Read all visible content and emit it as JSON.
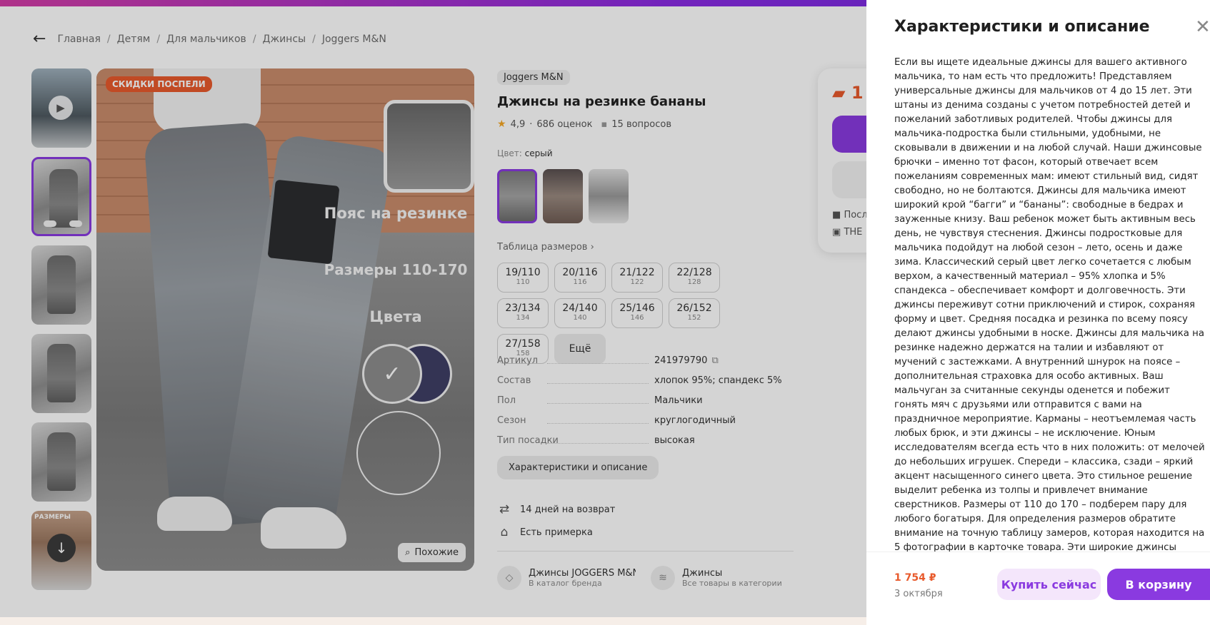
{
  "breadcrumbs": [
    "Главная",
    "Детям",
    "Для мальчиков",
    "Джинсы",
    "Joggers M&N"
  ],
  "gallery": {
    "badge": "СКИДКИ ПОСПЕЛИ",
    "promo_belt": "Пояс на резинке",
    "promo_sizes": "Размеры 110-170",
    "promo_colors": "Цвета",
    "similar_label": "Похожие",
    "thumb_label": "РАЗМЕРЫ"
  },
  "product": {
    "brand": "Joggers M&N",
    "title": "Джинсы на резинке бананы",
    "rating": "4,9",
    "reviews": "686 оценок",
    "questions": "15 вопросов",
    "color_label": "Цвет:",
    "color_value": "серый",
    "size_table_label": "Таблица размеров",
    "sizes": [
      {
        "size": "19/110",
        "height": "110"
      },
      {
        "size": "20/116",
        "height": "116"
      },
      {
        "size": "21/122",
        "height": "122"
      },
      {
        "size": "22/128",
        "height": "128"
      },
      {
        "size": "23/134",
        "height": "134"
      },
      {
        "size": "24/140",
        "height": "140"
      },
      {
        "size": "25/146",
        "height": "146"
      },
      {
        "size": "26/152",
        "height": "152"
      },
      {
        "size": "27/158",
        "height": "158"
      }
    ],
    "sizes_more": "Ещё",
    "specs": [
      {
        "key": "Артикул",
        "value": "241979790"
      },
      {
        "key": "Состав",
        "value": "хлопок 95%; спандекс 5%"
      },
      {
        "key": "Пол",
        "value": "Мальчики"
      },
      {
        "key": "Сезон",
        "value": "круглогодичный"
      },
      {
        "key": "Тип посадки",
        "value": "высокая"
      }
    ],
    "desc_button": "Характеристики и описание",
    "returns": "14 дней на возврат",
    "fitting": "Есть примерка",
    "link_brand_title": "Джинсы JOGGERS M&N",
    "link_brand_sub": "В каталог бренда",
    "link_cat_title": "Джинсы",
    "link_cat_sub": "Все товары в категории"
  },
  "buybox": {
    "price_partial": "1",
    "line1": "Посл",
    "line2": "THE"
  },
  "panel": {
    "title": "Характеристики и описание",
    "description": "Если вы ищете идеальные джинсы для вашего активного мальчика, то нам есть что предложить! Представляем универсальные джинсы для мальчиков от 4 до 15 лет. Эти штаны из денима созданы с учетом потребностей детей и пожеланий заботливых родителей. Чтобы джинсы для мальчика-подростка были стильными, удобными, не сковывали в движении и на любой случай. Наши джинсовые брючки – именно тот фасон, который отвечает всем пожеланиям современных мам: имеют стильный вид, сидят свободно, но не болтаются. Джинсы для мальчика имеют широкий крой “багги” и “бананы”: свободные в бедрах и зауженные книзу. Ваш ребенок может быть активным весь день, не чувствуя стеснения. Джинсы подростковые для мальчика подойдут на любой сезон – лето, осень и даже зима. Классический серый цвет легко сочетается с любым верхом, а качественный материал – 95% хлопка и 5% спандекса – обеспечивает комфорт и долговечность. Эти джинсы переживут сотни приключений и стирок, сохраняя форму и цвет. Средняя посадка и резинка по всему поясу делают джинсы удобными в носке. Джинсы для мальчика на резинке надежно держатся на талии и избавляют от мучений с застежками. А внутренний шнурок на поясе – дополнительная страховка для особо активных. Ваш мальчуган за считанные секунды оденется и побежит гонять мяч с друзьями или отправится с вами на праздничное мероприятие. Карманы – неотъемлемая часть любых брюк, и эти джинсы – не исключение. Юным исследователям всегда есть что в них положить: от мелочей до небольших игрушек. Спереди – классика, сзади – яркий акцент насыщенного синего цвета. Это стильное решение выделит ребенка из толпы и привлечет внимание сверстников. Размеры от 110 до 170 – подберем пару для любого богатыря. Для определения размеров обратите внимание на точную таблицу замеров, которая находится на 5 фотографии в карточке товара. Эти широкие джинсы станут для вашего мальчика незаменимой частью гардероба. В них он будет готов к любым подвигам. Подарите ребенку свободу движений и уверенность в себе!",
    "price": "1 754 ₽",
    "delivery_date": "3 октября",
    "buy_now": "Купить сейчас",
    "add_to_cart": "В корзину"
  },
  "colors": {
    "accent": "#8a3ae0",
    "price": "#e85a2c",
    "badge": "#e85a2c"
  }
}
